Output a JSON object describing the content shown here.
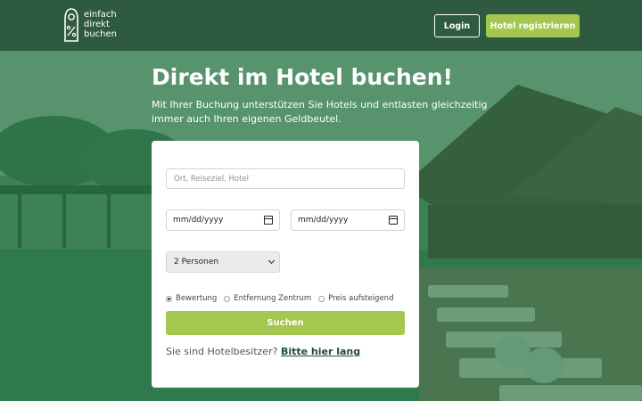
{
  "header": {
    "logo_lines": [
      "einfach",
      "direkt",
      "buchen"
    ],
    "login_label": "Login",
    "register_label": "Hotel registrieren"
  },
  "hero": {
    "title": "Direkt im Hotel buchen!",
    "subtitle": "Mit Ihrer Buchung unterstützen Sie Hotels und entlasten gleichzeitig immer auch Ihren eigenen Geldbeutel."
  },
  "form": {
    "destination_placeholder": "Ort, Reiseziel, Hotel",
    "date_from_value": "mm/dd/yyyy",
    "date_to_value": "mm/dd/yyyy",
    "guests_selected": "2 Personen",
    "sort_options": [
      {
        "label": "Bewertung",
        "checked": true
      },
      {
        "label": "Entfernung Zentrum",
        "checked": false
      },
      {
        "label": "Preis aufsteigend",
        "checked": false
      }
    ],
    "search_label": "Suchen",
    "owner_text": "Sie sind Hotelbesitzer?",
    "owner_link": "Bitte hier lang"
  },
  "colors": {
    "header_bg": "#2e5a40",
    "accent": "#a4c74f",
    "overlay": "#1e7a45"
  },
  "icons": {
    "logo": "door-hanger-percent-icon",
    "date": "calendar-icon",
    "select": "chevron-down-icon"
  }
}
